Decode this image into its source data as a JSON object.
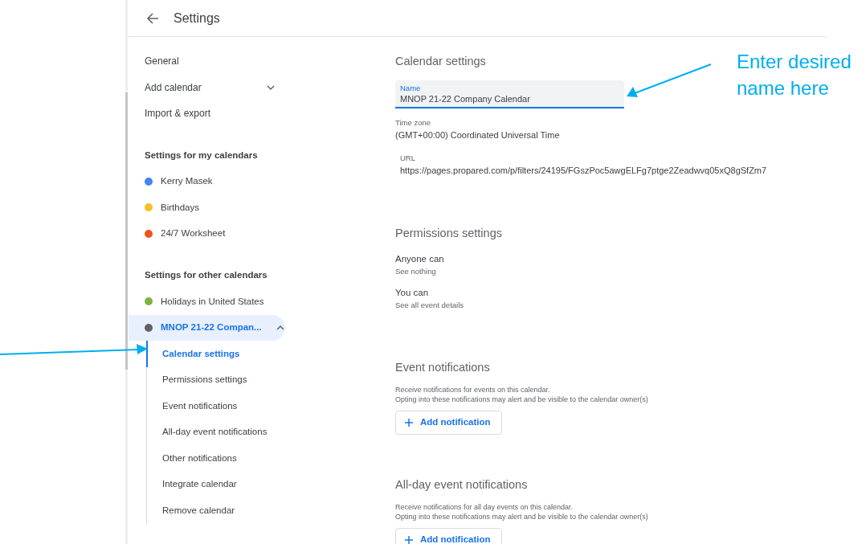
{
  "header": {
    "title": "Settings"
  },
  "sidebar": {
    "items": [
      {
        "label": "General",
        "kind": "link"
      },
      {
        "label": "Add calendar",
        "kind": "expander",
        "expanded": false
      },
      {
        "label": "Import & export",
        "kind": "link"
      }
    ],
    "sections": [
      {
        "heading": "Settings for my calendars",
        "calendars": [
          {
            "name": "Kerry Masek",
            "color": "#4285f4",
            "selected": false
          },
          {
            "name": "Birthdays",
            "color": "#f6bf26",
            "selected": false
          },
          {
            "name": "24/7 Worksheet",
            "color": "#f4511e",
            "selected": false
          }
        ]
      },
      {
        "heading": "Settings for other calendars",
        "calendars": [
          {
            "name": "Holidays in United States",
            "color": "#7cb342",
            "selected": false
          },
          {
            "name": "MNOP 21-22 Compan...",
            "color": "#616161",
            "selected": true,
            "expanded": true,
            "children": [
              {
                "label": "Calendar settings",
                "selected": true
              },
              {
                "label": "Permissions settings",
                "selected": false
              },
              {
                "label": "Event notifications",
                "selected": false
              },
              {
                "label": "All-day event notifications",
                "selected": false
              },
              {
                "label": "Other notifications",
                "selected": false
              },
              {
                "label": "Integrate calendar",
                "selected": false
              },
              {
                "label": "Remove calendar",
                "selected": false
              }
            ]
          }
        ]
      }
    ]
  },
  "calendar_settings": {
    "heading": "Calendar settings",
    "name_field": {
      "label": "Name",
      "value": "MNOP 21-22 Company Calendar"
    },
    "time_zone": {
      "label": "Time zone",
      "value": "(GMT+00:00) Coordinated Universal Time"
    },
    "url": {
      "label": "URL",
      "value": "https://pages.propared.com/p/filters/24195/FGszPoc5awgELFg7ptge2Zeadwvq05xQ8gSfZm7"
    }
  },
  "permissions": {
    "heading": "Permissions settings",
    "rows": [
      {
        "label": "Anyone can",
        "value": "See nothing"
      },
      {
        "label": "You can",
        "value": "See all event details"
      }
    ]
  },
  "notifications": [
    {
      "heading": "Event notifications",
      "description": [
        "Receive notifications for events on this calendar.",
        "Opting into these notifications may alert and be visible to the calendar owner(s)"
      ],
      "button": "Add notification"
    },
    {
      "heading": "All-day event notifications",
      "description": [
        "Receive notifications for all day events on this calendar.",
        "Opting into these notifications may alert and be visible to the calendar owner(s)"
      ],
      "button": "Add notification"
    }
  ],
  "annotations": [
    {
      "kind": "callout",
      "lines": [
        "Enter desired",
        "name here"
      ]
    },
    {
      "kind": "pointer"
    }
  ]
}
